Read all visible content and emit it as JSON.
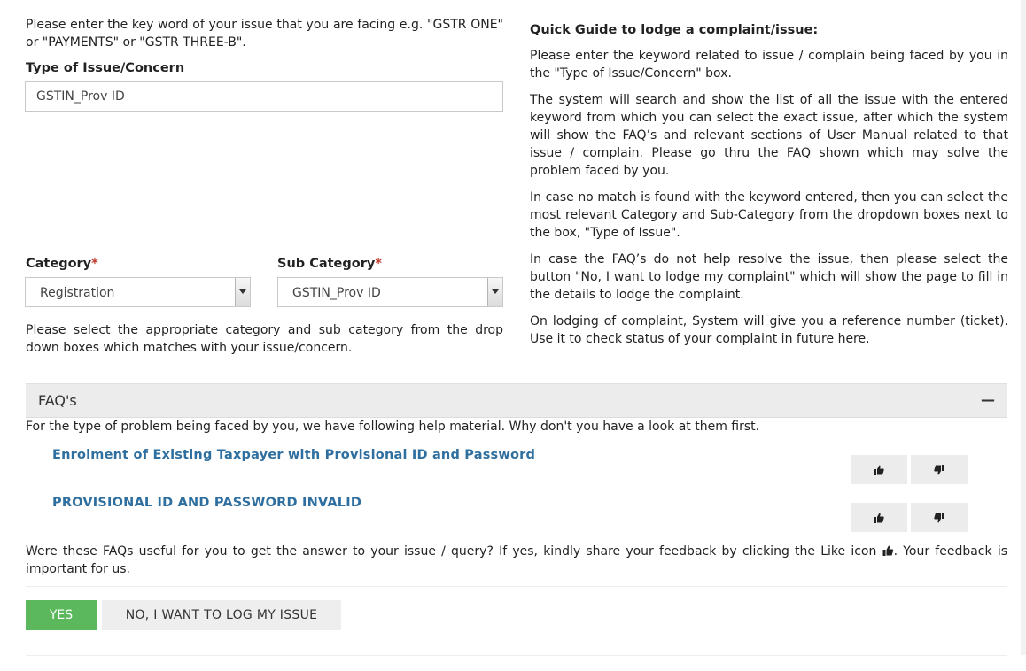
{
  "left": {
    "keyword_hint": "Please enter the key word of your issue that you are facing e.g. \"GSTR ONE\" or \"PAYMENTS\" or \"GSTR THREE-B\".",
    "type_label": "Type of Issue/Concern",
    "type_value": "GSTIN_Prov ID",
    "category_label": "Category",
    "category_value": "Registration",
    "subcategory_label": "Sub Category",
    "subcategory_value": "GSTIN_Prov ID",
    "required_mark": "*",
    "select_hint": "Please select the appropriate category and sub category from the drop down boxes which matches with your issue/concern."
  },
  "guide": {
    "title": "Quick Guide to lodge a complaint/issue:",
    "p1": "Please enter the keyword related to issue / complain being faced by you in the \"Type of Issue/Concern\" box.",
    "p2": "The system will search and show the list of all the issue with the entered keyword from which you can select the exact issue, after which the system will show the FAQ’s and relevant sections of User Manual related to that issue / complain. Please go thru the FAQ shown which may solve the problem faced by you.",
    "p3": "In case no match is found with the keyword entered, then you can select the most relevant Category and Sub-Category from the dropdown boxes next to the box, \"Type of Issue\".",
    "p4": "In case the FAQ’s do not help resolve the issue, then please select the button \"No, I want to lodge my complaint\" which will show the page to fill in the details to lodge the complaint.",
    "p5": "On lodging of complaint, System will give you a reference number (ticket). Use it to check status of your complaint in future here."
  },
  "faq": {
    "header": "FAQ's",
    "collapse_symbol": "—",
    "intro": "For the type of problem being faced by you, we have following help material. Why don't you have a look at them first.",
    "items": [
      {
        "title": "Enrolment of Existing Taxpayer with Provisional ID and Password"
      },
      {
        "title": "PROVISIONAL ID AND PASSWORD INVALID"
      }
    ],
    "feedback_before": "Were these FAQs useful for you to get the answer to your issue / query? If yes, kindly share your feedback by clicking the Like icon ",
    "feedback_after": ". Your feedback is important for us."
  },
  "buttons": {
    "yes": "YES",
    "no": "NO, I WANT TO LOG MY ISSUE"
  },
  "icons": {
    "like": "thumbs-up-icon",
    "dislike": "thumbs-down-icon"
  },
  "colors": {
    "yes_button": "#5cb85c",
    "faq_link": "#2f6f9f",
    "required": "#c0392b"
  }
}
